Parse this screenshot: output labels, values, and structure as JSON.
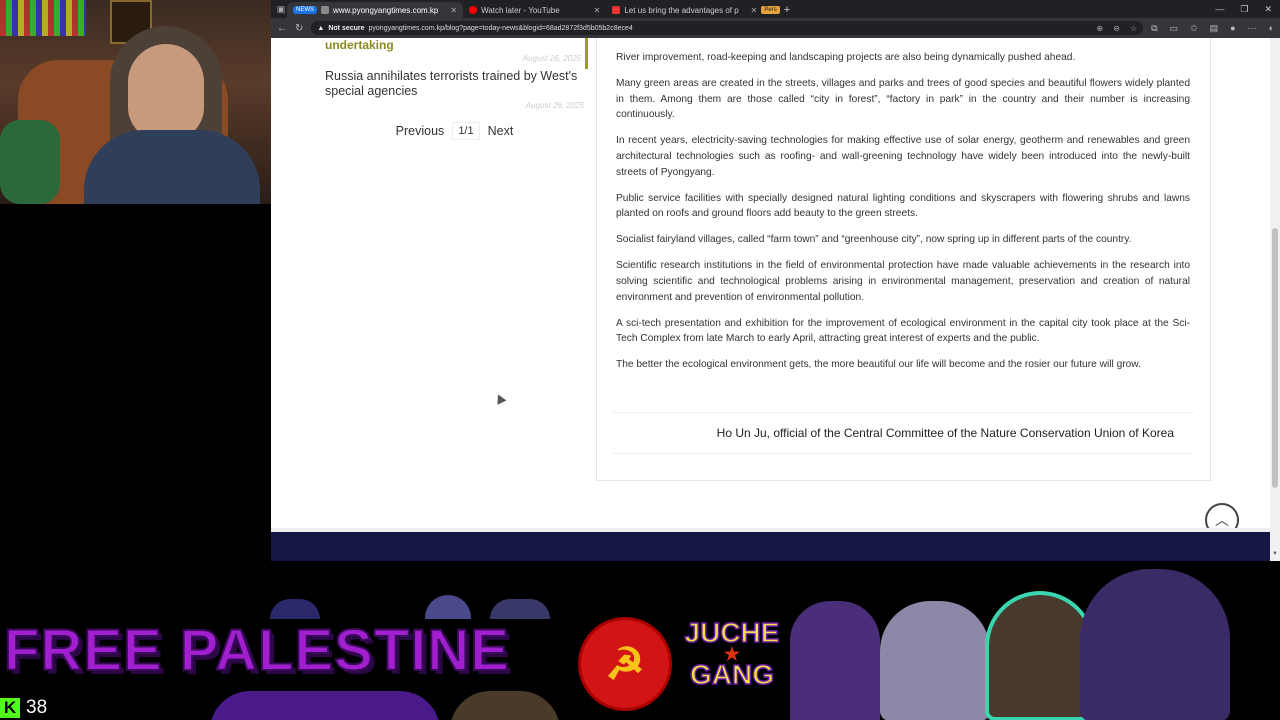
{
  "browser": {
    "tabs": [
      {
        "badge": "NEWS",
        "title": "www.pyongyangtimes.com.kp",
        "active": true
      },
      {
        "title": "Watch later - YouTube"
      },
      {
        "title": "Let us bring the advantages of p",
        "tag": "Pers"
      }
    ],
    "address": {
      "security": "Not secure",
      "url": "pyongyangtimes.com.kp/blog?page=today-news&blogid=68ad2872f3d5b05b2c8ece4"
    }
  },
  "sidebar": {
    "featured_title": "undertaking",
    "featured_date": "August 26, 2025",
    "items": [
      {
        "title": "Russia annihilates terrorists trained by West's special agencies",
        "date": "August 26, 2025"
      }
    ],
    "pager": {
      "prev": "Previous",
      "page": "1/1",
      "next": "Next"
    }
  },
  "article": {
    "paragraphs": [
      "River improvement, road-keeping and landscaping projects are also being dynamically pushed ahead.",
      "Many green areas are created in the streets, villages and parks and trees of good species and beautiful flowers widely planted in them. Among them are those called “city in forest”, “factory in park” in the country and their number is increasing continuously.",
      "In recent years, electricity-saving technologies for making effective use of solar energy, geotherm and renewables and green architectural technologies such as roofing- and wall-greening technology have widely been introduced into the newly-built streets of Pyongyang.",
      "Public service facilities with specially designed natural lighting conditions and skyscrapers with flowering shrubs and lawns planted on roofs and ground floors add beauty to the green streets.",
      "Socialist fairyland villages, called “farm town” and “greenhouse city”, now spring up in different parts of the country.",
      "Scientific research institutions in the field of environmental protection have made valuable achievements in the research into solving scientific and technological problems arising in environmental management, preservation and creation of natural environment and prevention of environmental pollution.",
      "A sci-tech presentation and exhibition for the improvement of ecological environment in the capital city took place at the Sci-Tech Complex from late March to early April, attracting great interest of experts and the public.",
      "The better the ecological environment gets, the more beautiful our life will become and the rosier our future will grow."
    ],
    "byline": "Ho Un Ju, official of the Central Committee of the Nature Conservation Union of Korea"
  },
  "overlay": {
    "banner": "FREE PALESTINE",
    "juche_line1": "JUCHE",
    "juche_line2": "GANG",
    "viewer_icon": "K",
    "viewer_count": "38"
  },
  "colors": {
    "accent_green": "#8c8c1e",
    "footer": "#171745",
    "banner_purple": "#a21fd0",
    "emblem_red": "#d21414"
  }
}
